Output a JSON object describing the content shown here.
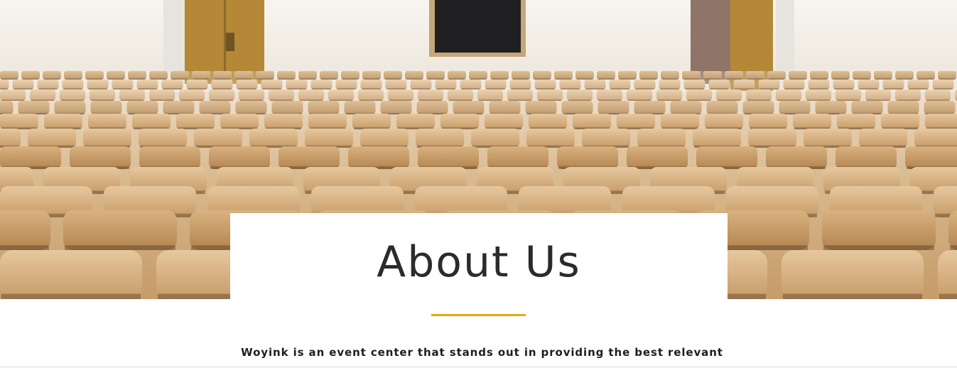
{
  "hero": {
    "image_icon": "auditorium-seats-photo-icon",
    "colors": {
      "wall": "#f4f1ec",
      "seat_light": "#e2c196",
      "seat_mid": "#d2a876",
      "seat_dark": "#b88a58",
      "door": "#b68a3c",
      "screen": "#1e1e1e"
    }
  },
  "about": {
    "title": "About Us",
    "underline_color": "#e8a90f",
    "intro": "Woyink is an event center that stands out in providing the best relevant"
  }
}
